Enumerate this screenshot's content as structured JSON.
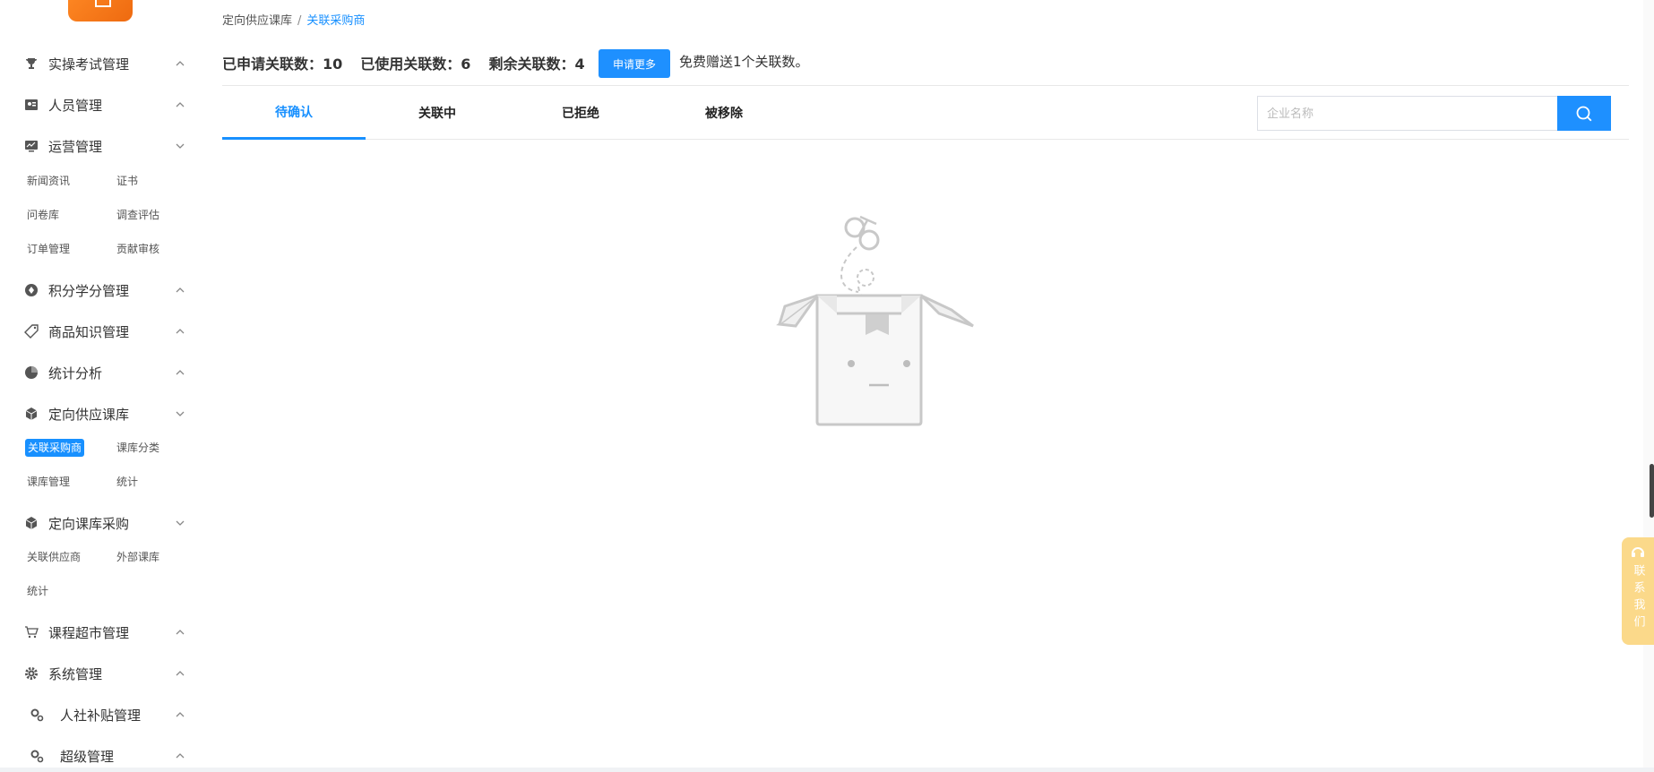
{
  "sidebar": {
    "groups": [
      {
        "label": "实操考试管理",
        "icon": "trophy-icon",
        "expanded": false
      },
      {
        "label": "人员管理",
        "icon": "user-card-icon",
        "expanded": false
      },
      {
        "label": "运营管理",
        "icon": "monitor-icon",
        "expanded": true
      },
      {
        "label": "积分学分管理",
        "icon": "points-icon",
        "expanded": false
      },
      {
        "label": "商品知识管理",
        "icon": "tag-icon",
        "expanded": false
      },
      {
        "label": "统计分析",
        "icon": "pie-chart-icon",
        "expanded": false
      },
      {
        "label": "定向供应课库",
        "icon": "cube-icon",
        "expanded": true
      },
      {
        "label": "定向课库采购",
        "icon": "cube-icon",
        "expanded": true
      },
      {
        "label": "课程超市管理",
        "icon": "cart-icon",
        "expanded": false
      },
      {
        "label": "系统管理",
        "icon": "gear-icon",
        "expanded": false
      },
      {
        "label": "人社补贴管理",
        "icon": "gears-icon",
        "expanded": false
      },
      {
        "label": "超级管理",
        "icon": "gears-icon",
        "expanded": false
      }
    ],
    "operations_items": [
      "新闻资讯",
      "证书",
      "问卷库",
      "调查评估",
      "订单管理",
      "贡献审核"
    ],
    "supply_items": [
      "关联采购商",
      "课库分类",
      "课库管理",
      "统计"
    ],
    "purchase_items": [
      "关联供应商",
      "外部课库",
      "统计"
    ]
  },
  "breadcrumb": {
    "parent": "定向供应课库",
    "separator": "/",
    "current": "关联采购商"
  },
  "stats": {
    "applied_label": "已申请关联数：",
    "applied_value": "10",
    "used_label": "已使用关联数：",
    "used_value": "6",
    "remaining_label": "剩余关联数：",
    "remaining_value": "4"
  },
  "apply_button": "申请更多",
  "free_note": "免费赠送1个关联数。",
  "tabs": [
    "待确认",
    "关联中",
    "已拒绝",
    "被移除"
  ],
  "active_tab": 0,
  "search": {
    "placeholder": "企业名称",
    "value": ""
  },
  "contact": {
    "label": "联系我们"
  },
  "colors": {
    "accent": "#1890ff",
    "logo": "#f07818",
    "contact": "#fbd98a"
  }
}
